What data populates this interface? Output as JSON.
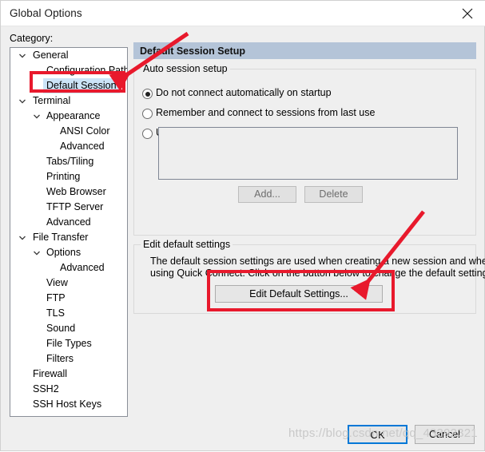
{
  "window": {
    "title": "Global Options",
    "close_icon": "close-icon"
  },
  "sidebar": {
    "label": "Category:",
    "items": [
      {
        "label": "General",
        "level": 0,
        "expander": "chevron-down-icon",
        "selected": false
      },
      {
        "label": "Configuration Paths",
        "level": 1,
        "expander": "",
        "selected": false
      },
      {
        "label": "Default Session",
        "level": 1,
        "expander": "",
        "selected": true
      },
      {
        "label": "Terminal",
        "level": 0,
        "expander": "chevron-down-icon",
        "selected": false
      },
      {
        "label": "Appearance",
        "level": 1,
        "expander": "chevron-down-icon",
        "selected": false
      },
      {
        "label": "ANSI Color",
        "level": 2,
        "expander": "",
        "selected": false
      },
      {
        "label": "Advanced",
        "level": 2,
        "expander": "",
        "selected": false
      },
      {
        "label": "Tabs/Tiling",
        "level": 1,
        "expander": "",
        "selected": false
      },
      {
        "label": "Printing",
        "level": 1,
        "expander": "",
        "selected": false
      },
      {
        "label": "Web Browser",
        "level": 1,
        "expander": "",
        "selected": false
      },
      {
        "label": "TFTP Server",
        "level": 1,
        "expander": "",
        "selected": false
      },
      {
        "label": "Advanced",
        "level": 1,
        "expander": "",
        "selected": false
      },
      {
        "label": "File Transfer",
        "level": 0,
        "expander": "chevron-down-icon",
        "selected": false
      },
      {
        "label": "Options",
        "level": 1,
        "expander": "chevron-down-icon",
        "selected": false
      },
      {
        "label": "Advanced",
        "level": 2,
        "expander": "",
        "selected": false
      },
      {
        "label": "View",
        "level": 1,
        "expander": "",
        "selected": false
      },
      {
        "label": "FTP",
        "level": 1,
        "expander": "",
        "selected": false
      },
      {
        "label": "TLS",
        "level": 1,
        "expander": "",
        "selected": false
      },
      {
        "label": "Sound",
        "level": 1,
        "expander": "",
        "selected": false
      },
      {
        "label": "File Types",
        "level": 1,
        "expander": "",
        "selected": false
      },
      {
        "label": "Filters",
        "level": 1,
        "expander": "",
        "selected": false
      },
      {
        "label": "Firewall",
        "level": 0,
        "expander": "",
        "selected": false
      },
      {
        "label": "SSH2",
        "level": 0,
        "expander": "",
        "selected": false
      },
      {
        "label": "SSH Host Keys",
        "level": 0,
        "expander": "",
        "selected": false
      }
    ]
  },
  "pane": {
    "header": "Default Session Setup",
    "auto_session": {
      "title": "Auto session setup",
      "options": [
        {
          "label": "Do not connect automatically on startup",
          "selected": true
        },
        {
          "label": "Remember and connect to sessions from last use",
          "selected": false
        },
        {
          "label": "Use auto session",
          "selected": false
        }
      ],
      "list_items": [],
      "add_button": "Add...",
      "delete_button": "Delete"
    },
    "edit_default": {
      "title": "Edit default settings",
      "description_line1": "The default session settings are used when creating a new session and when",
      "description_line2": "using Quick Connect.  Click on the button below to change the default settings.",
      "button": "Edit Default Settings..."
    }
  },
  "footer": {
    "ok_button": "OK",
    "cancel_button": "Cancel"
  },
  "watermark": {
    "text": "https://blog.csdn.net/qq_43392321"
  },
  "annotations": {
    "accent_color": "#e8192c",
    "highlight_color": "#cce4f7",
    "header_color": "#b4c4d8",
    "focus_color": "#0078d7",
    "boxes": [
      {
        "name": "default-session-highlight-box"
      },
      {
        "name": "edit-default-settings-highlight-box"
      }
    ],
    "arrows": [
      {
        "name": "arrow-to-default-session"
      },
      {
        "name": "arrow-to-edit-default-settings"
      }
    ]
  }
}
